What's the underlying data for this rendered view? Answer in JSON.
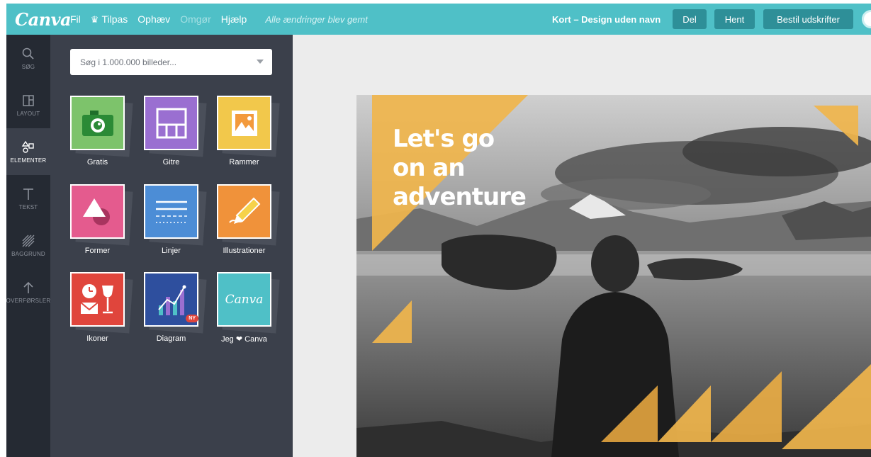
{
  "app": {
    "logo": "Canva",
    "menu": {
      "file": "Fil",
      "customize": "Tilpas",
      "undo": "Ophæv",
      "redo": "Omgør",
      "help": "Hjælp"
    },
    "save_status": "Alle ændringer blev gemt",
    "document_title": "Kort – Design uden navn",
    "buttons": {
      "share": "Del",
      "download": "Hent",
      "order_prints": "Bestil udskrifter"
    },
    "brand_color": "#4fc0c7"
  },
  "rail": {
    "items": [
      {
        "label": "SØG",
        "icon": "search-icon"
      },
      {
        "label": "LAYOUT",
        "icon": "layout-icon"
      },
      {
        "label": "ELEMENTER",
        "icon": "elements-icon",
        "active": true
      },
      {
        "label": "TEKST",
        "icon": "text-icon"
      },
      {
        "label": "BAGGRUND",
        "icon": "background-icon"
      },
      {
        "label": "OVERFØRSLER",
        "icon": "upload-icon"
      }
    ]
  },
  "panel": {
    "search_placeholder": "Søg i 1.000.000 billeder...",
    "categories": [
      {
        "label": "Gratis",
        "icon": "camera-icon",
        "color": "#7dc36b"
      },
      {
        "label": "Gitre",
        "icon": "grid-icon",
        "color": "#9a6fd1"
      },
      {
        "label": "Rammer",
        "icon": "frame-icon",
        "color": "#f2c84b"
      },
      {
        "label": "Former",
        "icon": "shapes-icon",
        "color": "#e45b8e"
      },
      {
        "label": "Linjer",
        "icon": "lines-icon",
        "color": "#4c8dd6"
      },
      {
        "label": "Illustrationer",
        "icon": "pencil-icon",
        "color": "#f0923a"
      },
      {
        "label": "Ikoner",
        "icon": "clock-wine-icon",
        "color": "#e0453c"
      },
      {
        "label": "Diagram",
        "icon": "chart-icon",
        "color": "#2e4f9e",
        "badge": "NY"
      },
      {
        "label": "Jeg ❤ Canva",
        "icon": "canva-logo-icon",
        "color": "#4fc0c7",
        "logo": "Canva"
      }
    ]
  },
  "design": {
    "headline_lines": [
      "Let's go",
      "on an",
      "adventure"
    ],
    "accent_color": "#f0b54c"
  }
}
